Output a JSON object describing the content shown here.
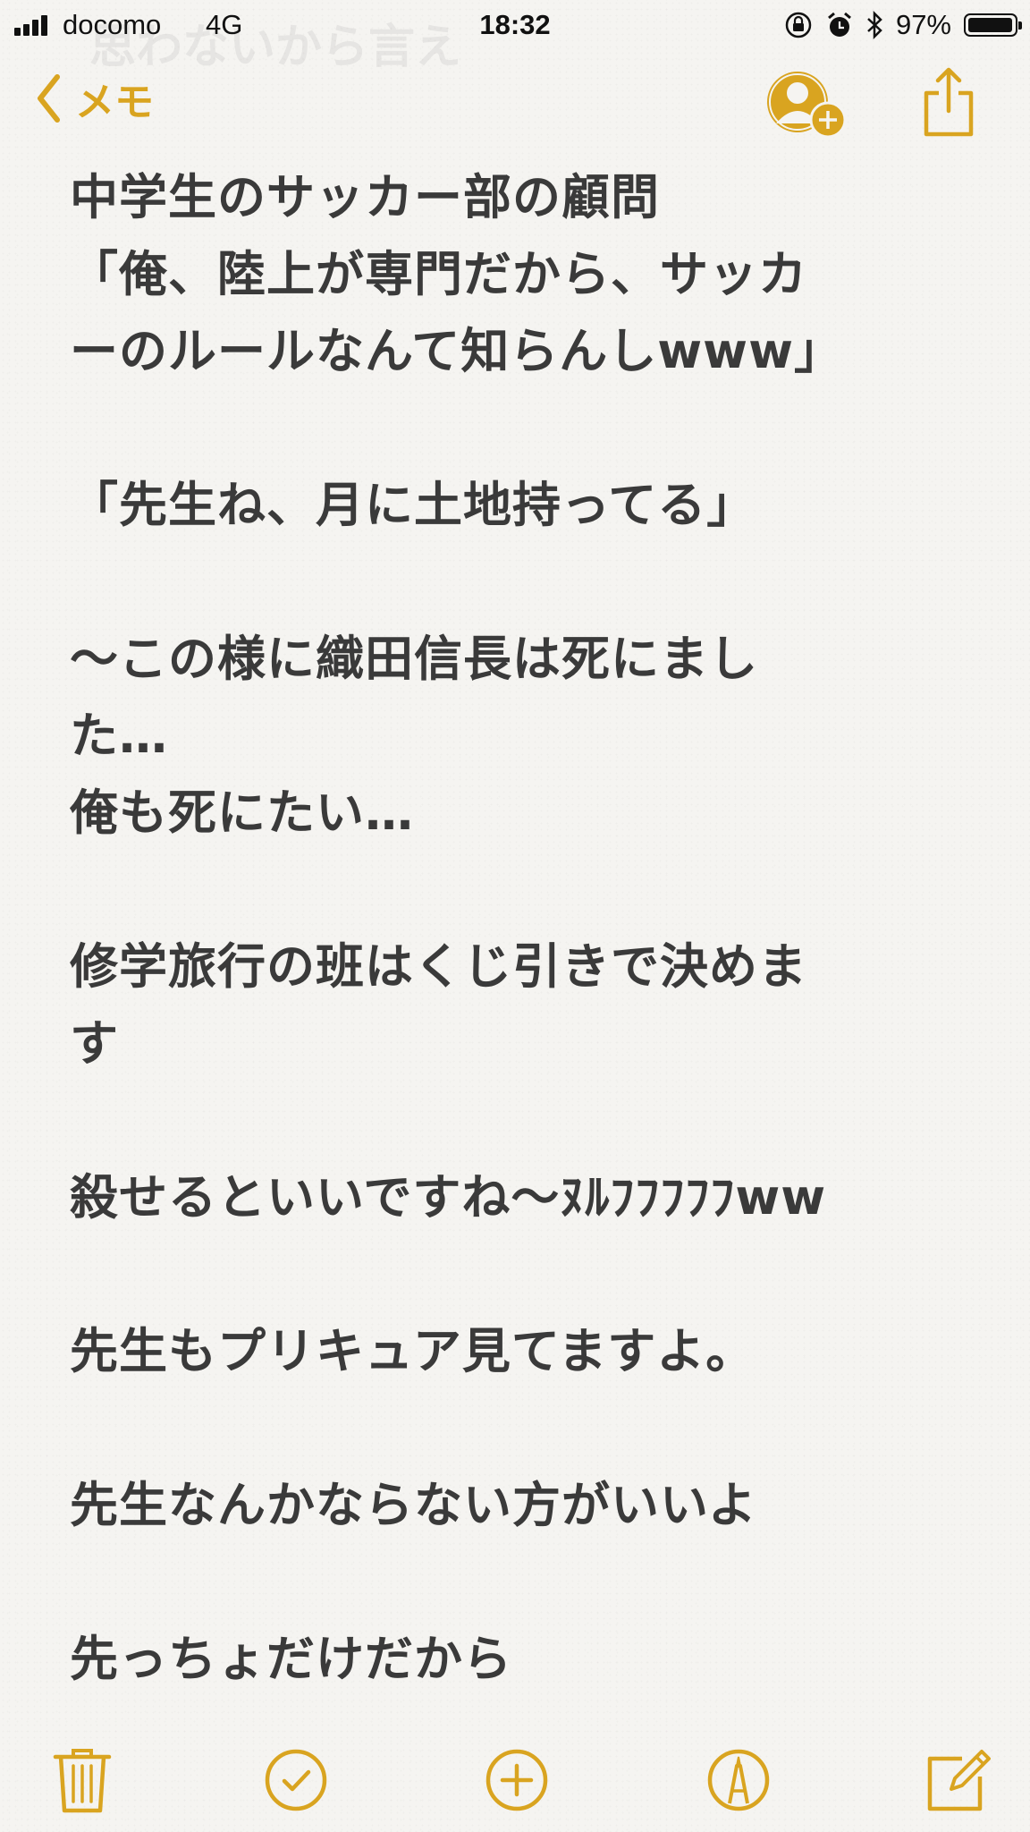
{
  "status_bar": {
    "carrier": "docomo",
    "network": "4G",
    "time": "18:32",
    "battery_percent": "97%",
    "battery_level": 0.97,
    "icons": [
      "orientation-lock-icon",
      "alarm-icon",
      "bluetooth-icon",
      "battery-icon"
    ]
  },
  "ghost_title": "思わないから言え",
  "nav": {
    "back_label": "メモ",
    "back_icon": "chevron-left-icon",
    "collab_icon": "add-person-icon",
    "share_icon": "share-icon"
  },
  "note": {
    "lines": [
      "中学生のサッカー部の顧問",
      "「俺、陸上が専門だから、サッカ",
      "ーのルールなんて知らんしwww」",
      "",
      "「先生ね、月に土地持ってる」",
      "",
      "〜この様に織田信長は死にまし",
      "た…",
      "俺も死にたい…",
      "",
      "修学旅行の班はくじ引きで決めま",
      "す",
      "",
      "殺せるといいですね〜ﾇﾙﾌﾌﾌﾌﾌww",
      "",
      "先生もプリキュア見てますよ。",
      "",
      "先生なんかならない方がいいよ",
      "",
      "先っちょだけだから"
    ]
  },
  "toolbar": {
    "icons": [
      "trash-icon",
      "checklist-icon",
      "add-icon",
      "markup-icon",
      "compose-icon"
    ]
  },
  "colors": {
    "accent": "#d9a420",
    "text": "#3a3a3a",
    "background": "#f5f4f1"
  }
}
